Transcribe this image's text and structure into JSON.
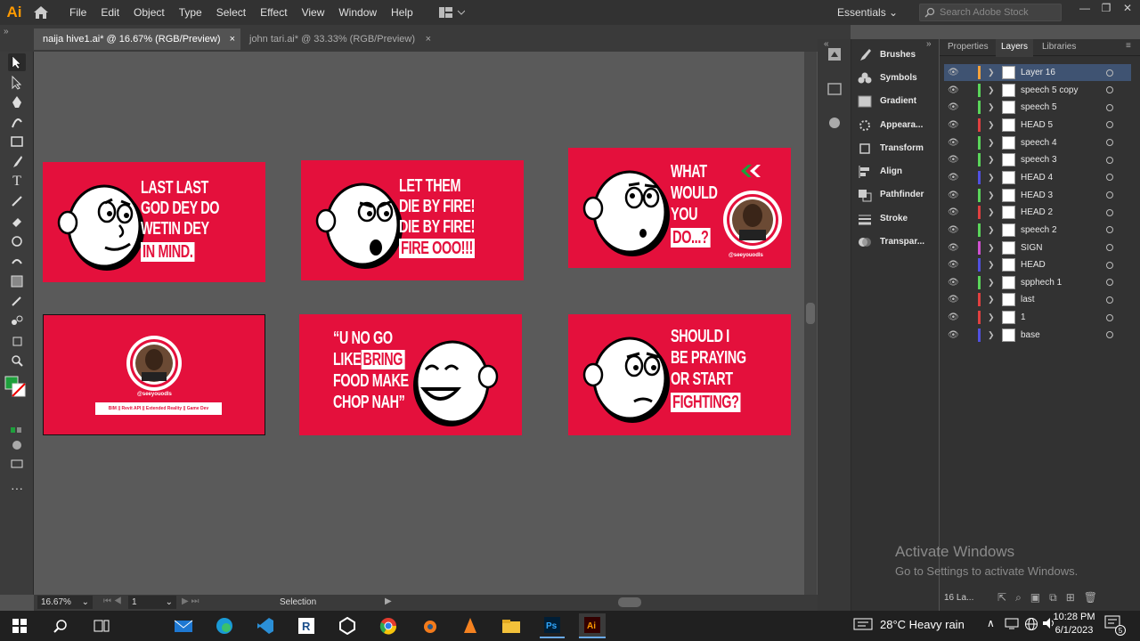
{
  "app": {
    "logo": "Ai",
    "menu": [
      "File",
      "Edit",
      "Object",
      "Type",
      "Select",
      "Effect",
      "View",
      "Window",
      "Help"
    ],
    "workspace": "Essentials",
    "search_placeholder": "Search Adobe Stock"
  },
  "tabs": [
    {
      "label": "naija hive1.ai* @ 16.67% (RGB/Preview)",
      "close": "×"
    },
    {
      "label": "john tari.ai* @ 33.33% (RGB/Preview)",
      "close": "×"
    }
  ],
  "artboards": {
    "a1": [
      "LAST LAST",
      "GOD DEY DO",
      "WETIN DEY",
      "IN MIND."
    ],
    "a2": [
      "LET THEM",
      "DIE BY FIRE!",
      "DIE BY FIRE!",
      "FIRE  OOO!!!"
    ],
    "a3": [
      "WHAT",
      "WOULD",
      "YOU",
      "DO...?"
    ],
    "a3_handle": "@seeyouodls",
    "a4_handle": "@seeyouodls",
    "a4_banner": "BIM  ||  Revit API  ||  Extended Reality  ||  Game Dev",
    "a5": [
      "“U NO GO",
      "LIKE BRING",
      "FOOD MAKE",
      "CHOP NAH”"
    ],
    "a5_highlight": "BRING",
    "a5_like": "LIKE",
    "a6": [
      "SHOULD I",
      "BE PRAYING",
      "OR START",
      "FIGHTING?"
    ]
  },
  "status": {
    "zoom": "16.67%",
    "artboard": "1",
    "tool": "Selection"
  },
  "panels": [
    "Brushes",
    "Symbols",
    "Gradient",
    "Appeara...",
    "Transform",
    "Align",
    "Pathfinder",
    "Stroke",
    "Transpar..."
  ],
  "right_tabs": [
    "Properties",
    "Layers",
    "Libraries"
  ],
  "layers": [
    {
      "name": "Layer 16",
      "color": "#f4a23c"
    },
    {
      "name": "speech 5 copy",
      "color": "#5ad45a"
    },
    {
      "name": "speech 5",
      "color": "#5ad45a"
    },
    {
      "name": "HEAD 5",
      "color": "#e04040"
    },
    {
      "name": "speech 4",
      "color": "#5ad45a"
    },
    {
      "name": "speech 3",
      "color": "#5ad45a"
    },
    {
      "name": "HEAD 4",
      "color": "#5050e0"
    },
    {
      "name": "HEAD 3",
      "color": "#5ad45a"
    },
    {
      "name": "HEAD 2",
      "color": "#e04040"
    },
    {
      "name": "speech 2",
      "color": "#5ad45a"
    },
    {
      "name": "SIGN",
      "color": "#d050d0"
    },
    {
      "name": "HEAD",
      "color": "#5050e0"
    },
    {
      "name": "spphech 1",
      "color": "#5ad45a"
    },
    {
      "name": "last",
      "color": "#e04040"
    },
    {
      "name": "1",
      "color": "#e04040"
    },
    {
      "name": "base",
      "color": "#5050e0"
    }
  ],
  "layers_count": "16 La...",
  "watermark": {
    "line1": "Activate Windows",
    "line2": "Go to Settings to activate Windows."
  },
  "taskbar": {
    "weather": "28°C  Heavy rain",
    "time": "10:28 PM",
    "date": "6/1/2023",
    "notif": "5"
  }
}
